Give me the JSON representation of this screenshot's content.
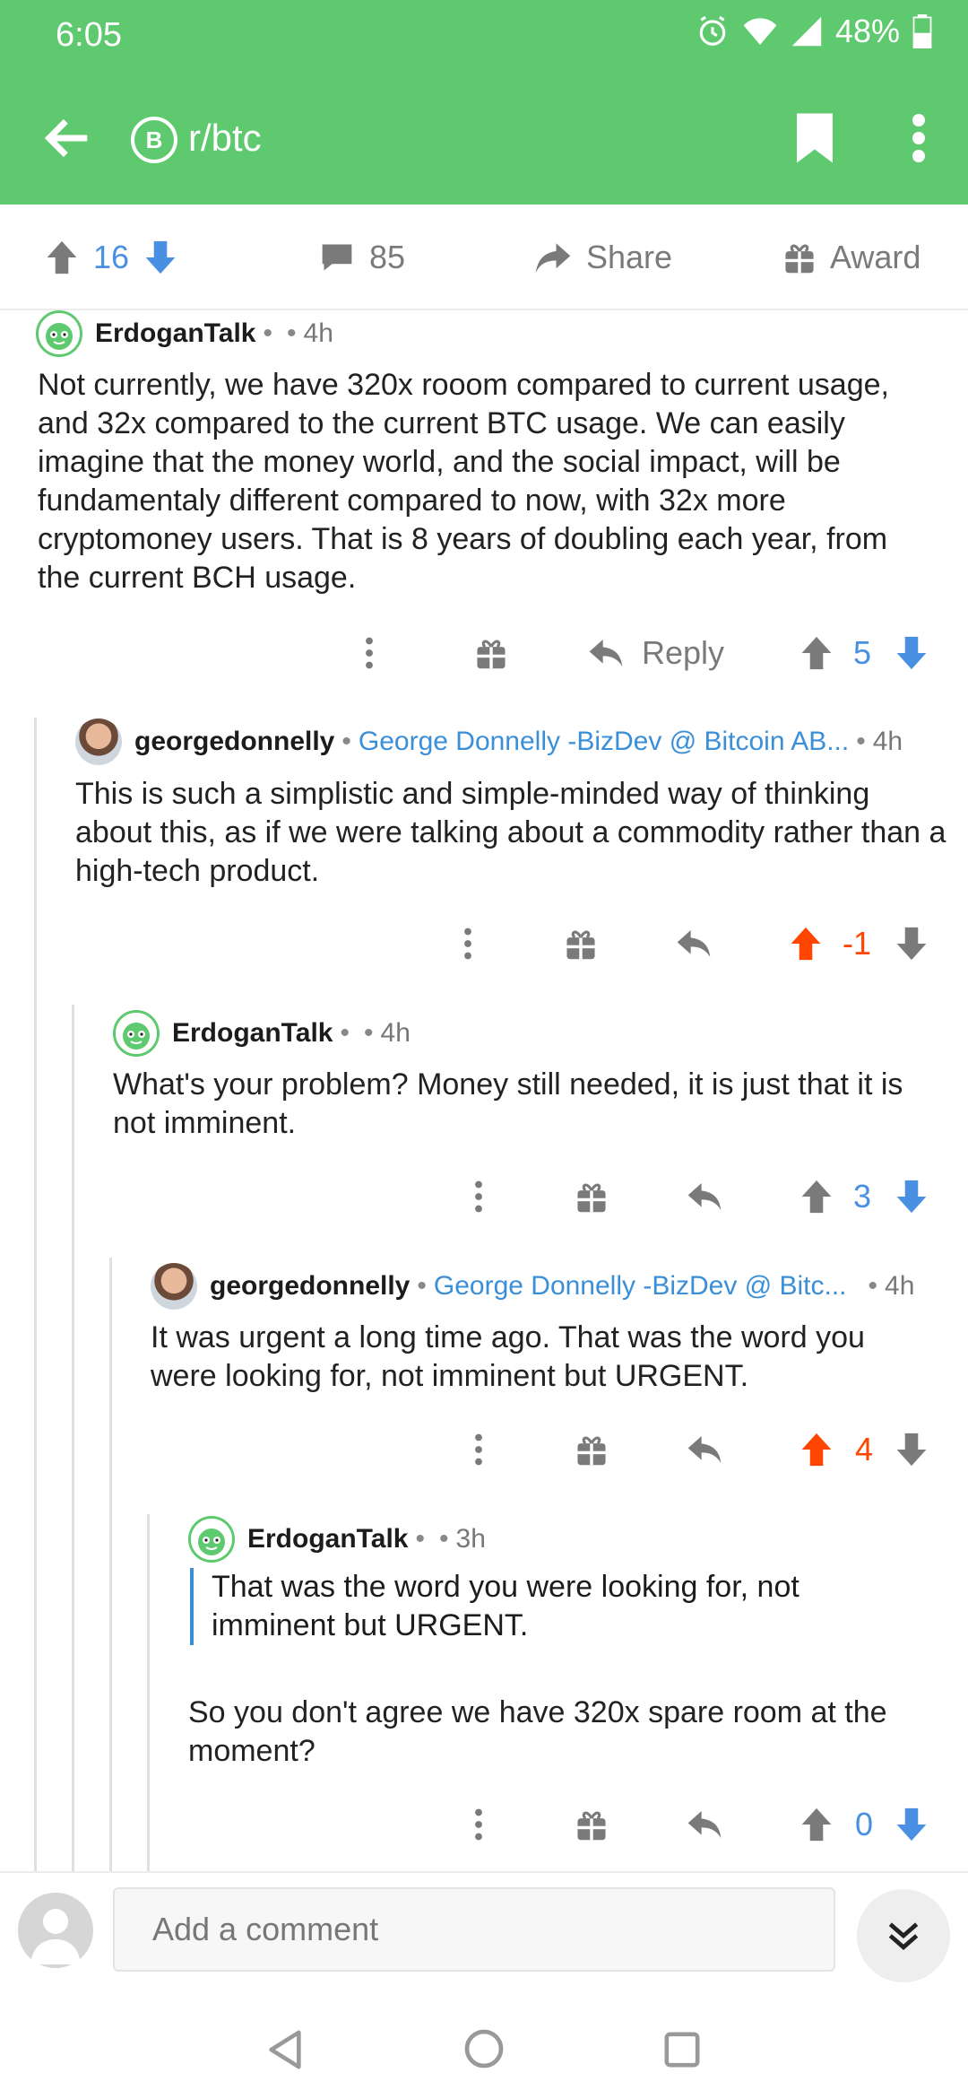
{
  "status_bar": {
    "time": "6:05",
    "battery": "48%"
  },
  "app_bar": {
    "title": "r/btc",
    "subreddit_icon_letter": "B"
  },
  "post_actions": {
    "score": "16",
    "comments": "85",
    "share": "Share",
    "award": "Award"
  },
  "comments": [
    {
      "author": "ErdoganTalk",
      "sep": "•",
      "age": "4h",
      "body": "Not currently, we have 320x rooom compared to current usage, and 32x compared to the current BTC usage. We can easily imagine that the money world, and the social impact, will be fundamentaly different compared to now, with 32x more cryptomoney users. That is 8 years of doubling each year, from the current BCH usage.",
      "reply": "Reply",
      "score": "5",
      "vote": "none"
    },
    {
      "author": "georgedonnelly",
      "flair": "George Donnelly -BizDev @ Bitcoin AB...",
      "age": "4h",
      "body": "This is such a simplistic and simple-minded way of thinking about this, as if we were talking about a commodity rather than a high-tech product.",
      "score": "-1",
      "vote": "up"
    },
    {
      "author": "ErdoganTalk",
      "sep": "•",
      "age": "4h",
      "body": "What's your problem? Money still needed, it is just that it is not imminent.",
      "score": "3",
      "vote": "none"
    },
    {
      "author": "georgedonnelly",
      "flair": "George Donnelly -BizDev @ Bitc...",
      "age": "4h",
      "body": "It was urgent a long time ago. That was the word you were looking for, not imminent but URGENT.",
      "score": "4",
      "vote": "up"
    },
    {
      "author": "ErdoganTalk",
      "sep": "•",
      "age": "3h",
      "quote": "That was the word you were looking for, not imminent but URGENT.",
      "body": "So you don't agree we have 320x spare room at the moment?",
      "score": "0",
      "vote": "none"
    }
  ],
  "composer": {
    "placeholder": "Add a comment"
  },
  "colors": {
    "brand_green": "#5fc96f",
    "upvote_orange": "#ff4500",
    "vote_blue": "#4a90e2",
    "flair_blue": "#3a8fd8"
  }
}
